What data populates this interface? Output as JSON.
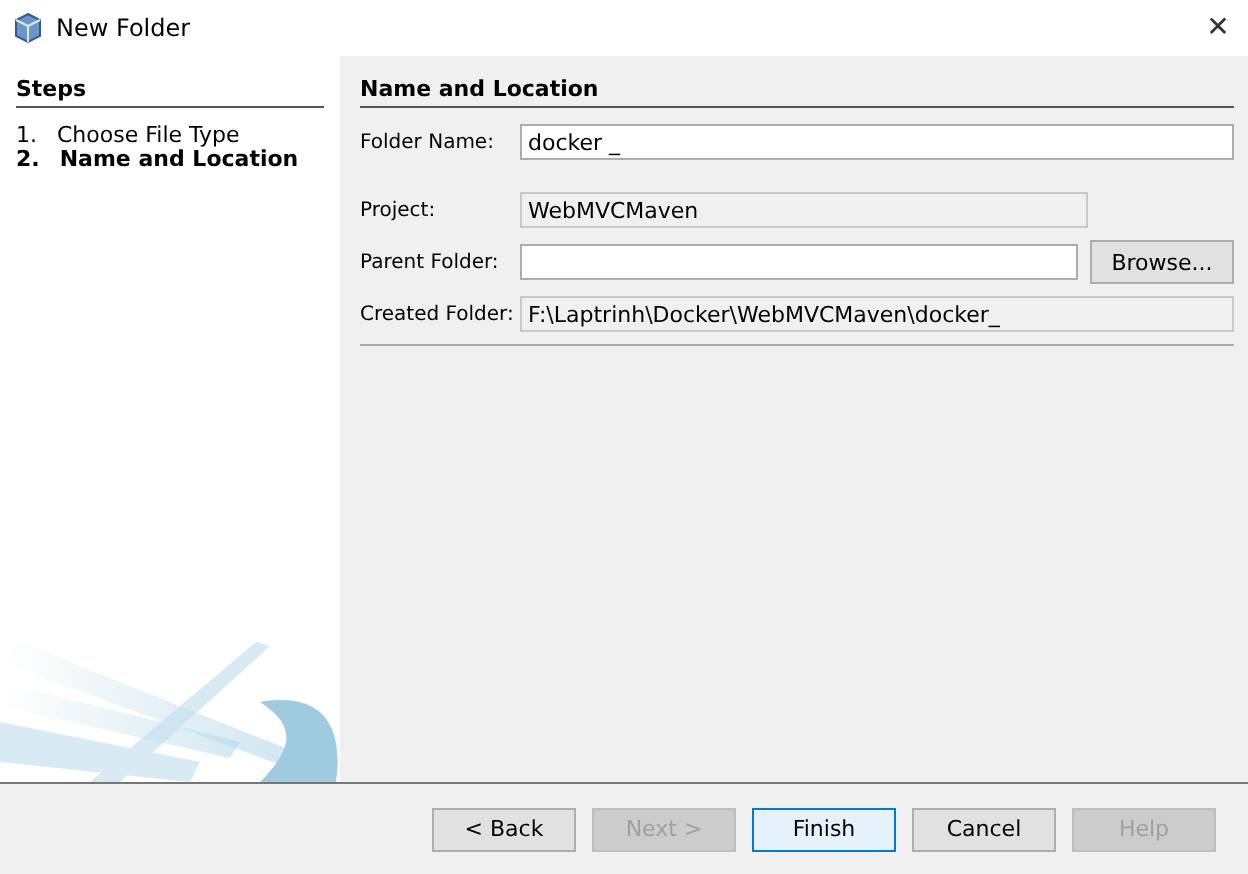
{
  "window": {
    "title": "New Folder",
    "close": "✕"
  },
  "steps": {
    "title": "Steps",
    "items": [
      {
        "number": "1.",
        "label": "Choose File Type",
        "selected": false
      },
      {
        "number": "2.",
        "label": "Name and Location",
        "selected": true
      }
    ]
  },
  "panel": {
    "title": "Name and Location",
    "fields": [
      {
        "kind": "editable",
        "label": "Folder Name:",
        "value": "docker _"
      },
      {
        "kind": "readonly",
        "label": "Project:",
        "value": "WebMVCMaven"
      },
      {
        "kind": "editable",
        "label": "Parent Folder:",
        "button": "Browse..."
      },
      {
        "kind": "readonly",
        "label": "Created Folder:",
        "value": "F:\\Laptrinh\\Docker\\WebMVCMaven\\docker_"
      }
    ]
  },
  "buttons": [
    {
      "label": "< Back",
      "disabled": false,
      "default": false
    },
    {
      "label": "Next >",
      "disabled": true,
      "default": false
    },
    {
      "label": "Finish",
      "disabled": false,
      "default": true
    },
    {
      "label": "Cancel",
      "disabled": false,
      "default": false
    },
    {
      "label": "Help",
      "disabled": true,
      "default": false
    }
  ]
}
